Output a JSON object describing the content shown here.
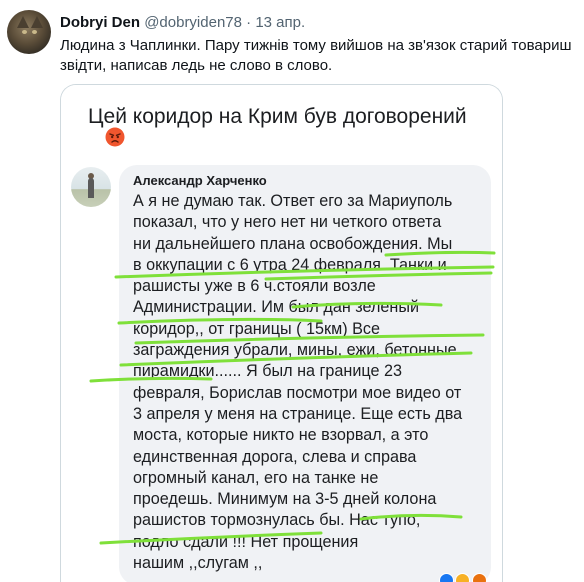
{
  "tweet": {
    "author_name": "Dobryi Den",
    "handle": "@dobryiden78",
    "separator": "·",
    "time": "13 апр.",
    "text": "Людина з Чаплинки. Пару тижнів тому вийшов на зв'язок старий товариш звідти, написав ледь не слово в слово."
  },
  "media": {
    "post_title": "Цей коридор на Крим був договорений",
    "title_emoji": "angry-face-icon",
    "comment": {
      "author": "Александр Харченко",
      "lines": [
        "А я не думаю так. Ответ его за Мариуполь",
        "показал, что у него нет ни четкого ответа",
        "ни дальнейшего плана освобождения. Мы",
        "в оккупации с 6 утра 24 февраля. Танки и",
        "рашисты уже в 6 ч.стояли возле",
        "Администрации.  Им был дан  зеленый",
        "коридор,, от границы ( 15км) Все",
        "заграждения убрали, мины, ежи, бетонные",
        "пирамидки...... Я был на границе 23",
        "февраля, Борислав посмотри мое видео от",
        "3 апреля у меня на странице. Еще есть два",
        "моста, которые никто не взорвал, а это",
        "единственная дорога, слева и справа",
        "огромный канал, его на танке не",
        "проедешь. Минимум на 3-5 дней колона",
        "рашистов тормознулась бы. Нас тупо,",
        "подло сдали !!! Нет прощения",
        "нашим ,,слугам ,,"
      ]
    },
    "highlight_color": "#7fe03a",
    "bubble_color": "#f0f2f5"
  }
}
